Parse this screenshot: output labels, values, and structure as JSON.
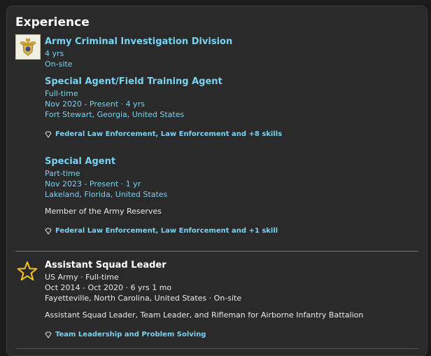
{
  "section": {
    "title": "Experience"
  },
  "cid": {
    "company": "Army Criminal Investigation Division",
    "duration": "4 yrs",
    "location_type": "On-site",
    "roles": [
      {
        "title": "Special Agent/Field Training Agent",
        "type": "Full-time",
        "dates": "Nov 2020 - Present · 4 yrs",
        "location": "Fort Stewart, Georgia, United States",
        "skills": "Federal Law Enforcement, Law Enforcement and +8 skills"
      },
      {
        "title": "Special Agent",
        "type": "Part-time",
        "dates": "Nov 2023 - Present · 1 yr",
        "location": "Lakeland, Florida, United States",
        "description": "Member of the Army Reserves",
        "skills": "Federal Law Enforcement, Law Enforcement and +1 skill"
      }
    ]
  },
  "army": {
    "title": "Assistant Squad Leader",
    "company_type": "US Army · Full-time",
    "dates": "Oct 2014 - Oct 2020 · 6 yrs 1 mo",
    "location": "Fayetteville, North Carolina, United States · On-site",
    "description": "Assistant Squad Leader, Team Leader, and Rifleman for Airborne Infantry Battalion",
    "skills": "Team Leadership and Problem Solving"
  },
  "icons": {
    "company_logo": "cid-badge-icon",
    "army_logo": "star-icon",
    "skill": "diamond-icon"
  },
  "colors": {
    "accent": "#79d3f2",
    "star": "#f5c518"
  }
}
